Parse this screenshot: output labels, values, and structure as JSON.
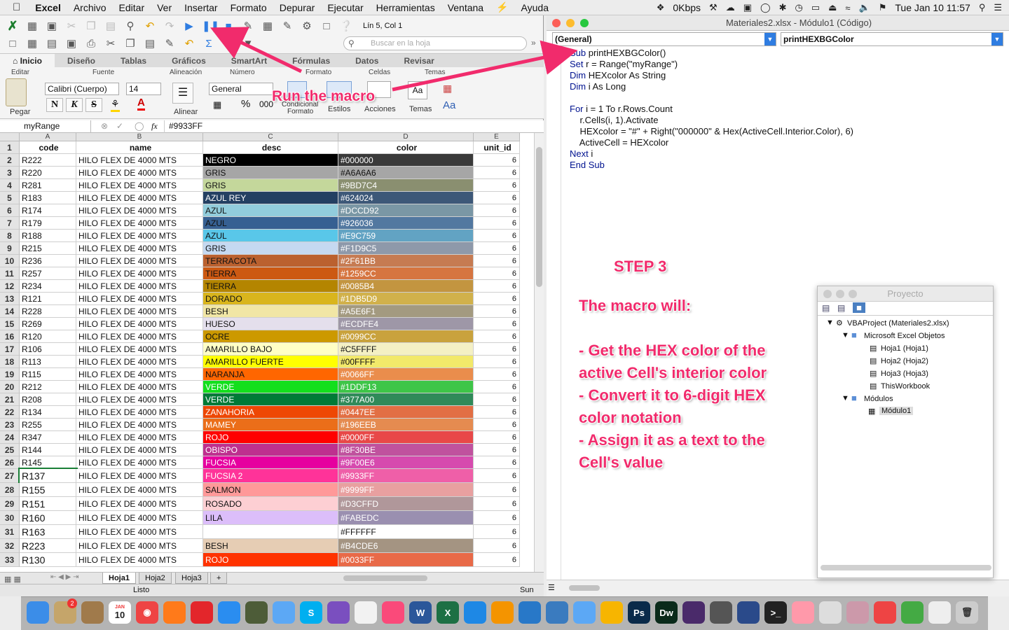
{
  "menubar": {
    "app": "Excel",
    "items": [
      "Archivo",
      "Editar",
      "Ver",
      "Insertar",
      "Formato",
      "Depurar",
      "Ejecutar",
      "Herramientas",
      "Ventana",
      "Ayuda"
    ],
    "network": "0Kbps",
    "clock": "Tue Jan 10  11:57"
  },
  "excel": {
    "toolbar": {
      "position": "Lín 5, Col 1",
      "search_placeholder": "Buscar en la hoja"
    },
    "ribbon_tabs": [
      "Inicio",
      "Diseño",
      "Tablas",
      "Gráficos",
      "SmartArt",
      "Fórmulas",
      "Datos",
      "Revisar"
    ],
    "ribbon": {
      "group_editar": "Editar",
      "group_fuente": "Fuente",
      "group_alineacion": "Alineación",
      "group_numero": "Número",
      "group_formato": "Formato",
      "group_celdas": "Celdas",
      "group_temas": "Temas",
      "pegar": "Pegar",
      "font_name": "Calibri (Cuerpo)",
      "font_size": "14",
      "bold": "N",
      "italic": "K",
      "strike": "S",
      "alinear": "Alinear",
      "number_format": "General",
      "percent": "%",
      "thousands": "000",
      "condicional": "Condicional",
      "formato": "Formato",
      "estilos": "Estilos",
      "acciones": "Acciones",
      "temas": "Temas",
      "aa": "Aa",
      "aa2": "Aa"
    },
    "formula_bar": {
      "name_box": "myRange",
      "fx": "fx",
      "formula": "#9933FF"
    },
    "columns": [
      "A",
      "B",
      "C",
      "D",
      "E"
    ],
    "headers": [
      "code",
      "name",
      "desc",
      "color",
      "unit_id"
    ],
    "rows": [
      {
        "n": "2",
        "code": "R222",
        "name": "HILO FLEX DE 4000  MTS",
        "desc": "NEGRO",
        "color": "#000000",
        "unit": "6",
        "dbg": "#000000",
        "cbg": "#3a3a3a",
        "dfg": "#fff",
        "cfg": "#fff"
      },
      {
        "n": "3",
        "code": "R220",
        "name": "HILO FLEX DE 4000  MTS",
        "desc": "GRIS",
        "color": "#A6A6A6",
        "unit": "6",
        "dbg": "#a6a6a6",
        "cbg": "#a6a6a6",
        "dfg": "#111",
        "cfg": "#111"
      },
      {
        "n": "4",
        "code": "R281",
        "name": "HILO FLEX DE 4000  MTS",
        "desc": "GRIS",
        "color": "#9BD7C4",
        "unit": "6",
        "dbg": "#c4d79b",
        "cbg": "#8a8f70",
        "dfg": "#111",
        "cfg": "#fff"
      },
      {
        "n": "5",
        "code": "R183",
        "name": "HILO FLEX DE 4000  MTS",
        "desc": "AZUL REY",
        "color": "#624024",
        "unit": "6",
        "dbg": "#244062",
        "cbg": "#3d5878",
        "dfg": "#fff",
        "cfg": "#fff"
      },
      {
        "n": "6",
        "code": "R174",
        "name": "HILO FLEX DE 4000  MTS",
        "desc": "AZUL",
        "color": "#DCCD92",
        "unit": "6",
        "dbg": "#92cddc",
        "cbg": "#7a97a5",
        "dfg": "#111",
        "cfg": "#fff"
      },
      {
        "n": "7",
        "code": "R179",
        "name": "HILO FLEX DE 4000  MTS",
        "desc": "AZUL",
        "color": "#926036",
        "unit": "6",
        "dbg": "#366092",
        "cbg": "#5278a0",
        "dfg": "#111",
        "cfg": "#fff"
      },
      {
        "n": "8",
        "code": "R188",
        "name": "HILO FLEX DE 4000  MTS",
        "desc": "AZUL",
        "color": "#E9C759",
        "unit": "6",
        "dbg": "#59c7e9",
        "cbg": "#62a3c3",
        "dfg": "#111",
        "cfg": "#fff"
      },
      {
        "n": "9",
        "code": "R215",
        "name": "HILO FLEX DE 4000  MTS",
        "desc": "GRIS",
        "color": "#F1D9C5",
        "unit": "6",
        "dbg": "#c5d9f1",
        "cbg": "#8e99aa",
        "dfg": "#111",
        "cfg": "#fff"
      },
      {
        "n": "10",
        "code": "R236",
        "name": "HILO FLEX DE 4000  MTS",
        "desc": "TERRACOTA",
        "color": "#2F61BB",
        "unit": "6",
        "dbg": "#bb612f",
        "cbg": "#c67b52",
        "dfg": "#111",
        "cfg": "#fff"
      },
      {
        "n": "11",
        "code": "R257",
        "name": "HILO FLEX DE 4000  MTS",
        "desc": "TIERRA",
        "color": "#1259CC",
        "unit": "6",
        "dbg": "#cc5912",
        "cbg": "#d67540",
        "dfg": "#111",
        "cfg": "#fff"
      },
      {
        "n": "12",
        "code": "R234",
        "name": "HILO FLEX DE 4000  MTS",
        "desc": "TIERRA",
        "color": "#0085B4",
        "unit": "6",
        "dbg": "#b48500",
        "cbg": "#c39540",
        "dfg": "#111",
        "cfg": "#fff"
      },
      {
        "n": "13",
        "code": "R121",
        "name": "HILO FLEX DE 4000  MTS",
        "desc": "DORADO",
        "color": "#1DB5D9",
        "unit": "6",
        "dbg": "#d9b51d",
        "cbg": "#d1b14b",
        "dfg": "#111",
        "cfg": "#fff"
      },
      {
        "n": "14",
        "code": "R228",
        "name": "HILO FLEX DE 4000  MTS",
        "desc": "BESH",
        "color": "#A5E6F1",
        "unit": "6",
        "dbg": "#f1e6a5",
        "cbg": "#a39a80",
        "dfg": "#111",
        "cfg": "#fff"
      },
      {
        "n": "15",
        "code": "R269",
        "name": "HILO FLEX DE 4000  MTS",
        "desc": "HUESO",
        "color": "#ECDFE4",
        "unit": "6",
        "dbg": "#e4dfec",
        "cbg": "#9e97a7",
        "dfg": "#111",
        "cfg": "#fff"
      },
      {
        "n": "16",
        "code": "R120",
        "name": "HILO FLEX DE 4000  MTS",
        "desc": "OCRE",
        "color": "#0099CC",
        "unit": "6",
        "dbg": "#cc9900",
        "cbg": "#c9a23d",
        "dfg": "#111",
        "cfg": "#fff"
      },
      {
        "n": "17",
        "code": "R106",
        "name": "HILO FLEX DE 4000  MTS",
        "desc": "AMARILLO BAJO",
        "color": "#C5FFFF",
        "unit": "6",
        "dbg": "#ffffc5",
        "cbg": "#f4f0c4",
        "dfg": "#111",
        "cfg": "#111"
      },
      {
        "n": "18",
        "code": "R113",
        "name": "HILO FLEX DE 4000  MTS",
        "desc": "AMARILLO FUERTE",
        "color": "#00FFFF",
        "unit": "6",
        "dbg": "#ffff00",
        "cbg": "#f2e96a",
        "dfg": "#111",
        "cfg": "#111"
      },
      {
        "n": "19",
        "code": "R115",
        "name": "HILO FLEX DE 4000  MTS",
        "desc": "NARANJA",
        "color": "#0066FF",
        "unit": "6",
        "dbg": "#ff6600",
        "cbg": "#ea8d4c",
        "dfg": "#111",
        "cfg": "#fff"
      },
      {
        "n": "20",
        "code": "R212",
        "name": "HILO FLEX DE 4000  MTS",
        "desc": "VERDE",
        "color": "#1DDF13",
        "unit": "6",
        "dbg": "#13df1d",
        "cbg": "#3ec548",
        "dfg": "#fff",
        "cfg": "#fff"
      },
      {
        "n": "21",
        "code": "R208",
        "name": "HILO FLEX DE 4000  MTS",
        "desc": "VERDE",
        "color": "#377A00",
        "unit": "6",
        "dbg": "#007a37",
        "cbg": "#308a59",
        "dfg": "#fff",
        "cfg": "#fff"
      },
      {
        "n": "22",
        "code": "R134",
        "name": "HILO FLEX DE 4000  MTS",
        "desc": "ZANAHORIA",
        "color": "#0447EE",
        "unit": "6",
        "dbg": "#ee4704",
        "cbg": "#e26f44",
        "dfg": "#fff",
        "cfg": "#fff"
      },
      {
        "n": "23",
        "code": "R255",
        "name": "HILO FLEX DE 4000  MTS",
        "desc": "MAMEY",
        "color": "#196EEB",
        "unit": "6",
        "dbg": "#eb6e19",
        "cbg": "#e58b50",
        "dfg": "#fff",
        "cfg": "#fff"
      },
      {
        "n": "24",
        "code": "R347",
        "name": "HILO FLEX DE 4000  MTS",
        "desc": "ROJO",
        "color": "#0000FF",
        "unit": "6",
        "dbg": "#ff0000",
        "cbg": "#e84848",
        "dfg": "#fff",
        "cfg": "#fff"
      },
      {
        "n": "25",
        "code": "R144",
        "name": "HILO FLEX DE 4000  MTS",
        "desc": "OBISPO",
        "color": "#8F30BE",
        "unit": "6",
        "dbg": "#be308f",
        "cbg": "#c0529e",
        "dfg": "#fff",
        "cfg": "#fff"
      },
      {
        "n": "26",
        "code": "R145",
        "name": "HILO FLEX DE 4000  MTS",
        "desc": "FUCSIA",
        "color": "#9F00E6",
        "unit": "6",
        "dbg": "#e6009f",
        "cbg": "#d64aae",
        "dfg": "#fff",
        "cfg": "#fff"
      },
      {
        "n": "27",
        "code": "R137",
        "name": "HILO FLEX DE 4000  MTS",
        "desc": "FUCSIA 2",
        "color": "#9933FF",
        "unit": "6",
        "dbg": "#ff3399",
        "cbg": "#ef5fa8",
        "dfg": "#fff",
        "cfg": "#fff"
      },
      {
        "n": "28",
        "code": "R155",
        "name": "HILO FLEX DE 4000  MTS",
        "desc": "SALMON",
        "color": "#9999FF",
        "unit": "6",
        "dbg": "#ff9999",
        "cbg": "#e8a0a0",
        "dfg": "#111",
        "cfg": "#fff"
      },
      {
        "n": "29",
        "code": "R151",
        "name": "HILO FLEX DE 4000  MTS",
        "desc": "ROSADO",
        "color": "#D3CFFD",
        "unit": "6",
        "dbg": "#fdcfd3",
        "cbg": "#b0979a",
        "dfg": "#111",
        "cfg": "#fff"
      },
      {
        "n": "30",
        "code": "R160",
        "name": "HILO FLEX DE 4000  MTS",
        "desc": "LILA",
        "color": "#FABEDC",
        "unit": "6",
        "dbg": "#dcbefa",
        "cbg": "#9a8fb0",
        "dfg": "#111",
        "cfg": "#fff"
      },
      {
        "n": "31",
        "code": "R163",
        "name": "HILO FLEX DE 4000  MTS",
        "desc": "",
        "color": "#FFFFFF",
        "unit": "6",
        "dbg": "#ffffff",
        "cbg": "#ffffff",
        "dfg": "#111",
        "cfg": "#111"
      },
      {
        "n": "32",
        "code": "R223",
        "name": "HILO FLEX DE 4000  MTS",
        "desc": "BESH",
        "color": "#B4CDE6",
        "unit": "6",
        "dbg": "#e6cdb4",
        "cbg": "#a49482",
        "dfg": "#111",
        "cfg": "#fff"
      },
      {
        "n": "33",
        "code": "R130",
        "name": "HILO FLEX DE 4000  MTS",
        "desc": "ROJO",
        "color": "#0033FF",
        "unit": "6",
        "dbg": "#ff3300",
        "cbg": "#e86a48",
        "dfg": "#fff",
        "cfg": "#fff"
      }
    ],
    "sheet_tabs": [
      "Hoja1",
      "Hoja2",
      "Hoja3"
    ],
    "status": "Listo",
    "status_right": "Sun"
  },
  "vba": {
    "title": "Materiales2.xlsx - Módulo1 (Código)",
    "object_select": "(General)",
    "proc_select": "printHEXBGColor",
    "code_lines": [
      {
        "kw": "Sub ",
        "rest": "printHEXBGColor()"
      },
      {
        "kw": "Set ",
        "rest": "r = Range(\"myRange\")"
      },
      {
        "kw": "Dim ",
        "rest": "HEXcolor As String"
      },
      {
        "kw": "Dim ",
        "rest": "i As Long"
      },
      {
        "kw": "",
        "rest": ""
      },
      {
        "kw": "For ",
        "rest": "i = 1 To r.Rows.Count"
      },
      {
        "kw": "",
        "rest": "    r.Cells(i, 1).Activate"
      },
      {
        "kw": "",
        "rest": "    HEXcolor = \"#\" + Right(\"000000\" & Hex(ActiveCell.Interior.Color), 6)"
      },
      {
        "kw": "",
        "rest": "    ActiveCell = HEXcolor"
      },
      {
        "kw": "Next ",
        "rest": "i"
      },
      {
        "kw": "End Sub",
        "rest": ""
      }
    ],
    "annotations": {
      "run": "Run the macro",
      "step": "STEP 3",
      "l1": "The macro will:",
      "l2": "- Get the HEX color of the",
      "l3": "active Cell's interior color",
      "l4": "- Convert it to 6-digit HEX",
      "l5": "color notation",
      "l6": "- Assign it as a text to the",
      "l7": "Cell's value"
    },
    "project": {
      "title": "Proyecto",
      "root": "VBAProject (Materiales2.xlsx)",
      "folder1": "Microsoft Excel Objetos",
      "items": [
        "Hoja1 (Hoja1)",
        "Hoja2 (Hoja2)",
        "Hoja3 (Hoja3)",
        "ThisWorkbook"
      ],
      "folder2": "Módulos",
      "module": "Módulo1"
    }
  },
  "dock": {
    "badge_mail": "2",
    "calendar_month": "JAN",
    "calendar_day": "10",
    "icons": [
      "finder-icon",
      "preview-icon",
      "notes-icon",
      "calendar-icon",
      "chrome-icon",
      "firefox-icon",
      "opera-icon",
      "safari-icon",
      "compass-icon",
      "messages-icon",
      "skype-icon",
      "viber-icon",
      "textedit-icon",
      "itunes-icon",
      "word-icon",
      "excel-icon",
      "keynote-icon",
      "sublime-icon",
      "vscode-icon",
      "sourcetree-icon",
      "finder2-icon",
      "sketch-icon",
      "photoshop-icon",
      "dreamweaver-icon",
      "illustrator-icon",
      "keychain-icon",
      "virtualbox-icon",
      "terminal-icon",
      "photos-icon",
      "sequel-icon",
      "compressor-icon",
      "heart-icon",
      "xcode-icon",
      "file-icon",
      "trash-icon"
    ]
  }
}
